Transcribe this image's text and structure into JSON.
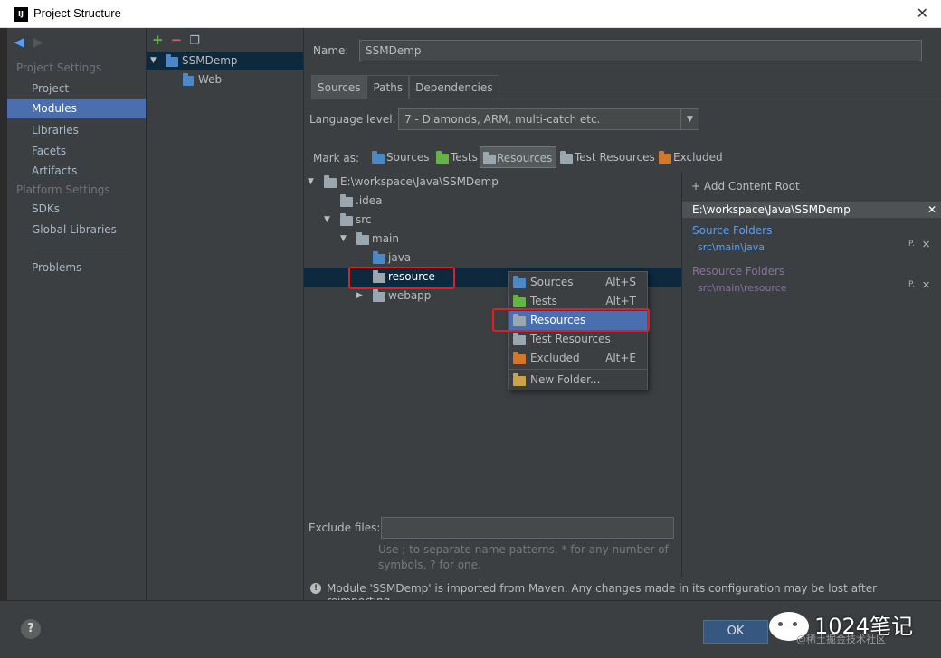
{
  "window": {
    "title": "Project Structure",
    "app_icon": "IJ"
  },
  "nav": {
    "group1": "Project Settings",
    "items1": [
      "Project",
      "Modules",
      "Libraries",
      "Facets",
      "Artifacts"
    ],
    "group2": "Platform Settings",
    "items2": [
      "SDKs",
      "Global Libraries"
    ],
    "items3": [
      "Problems"
    ],
    "selected": "Modules"
  },
  "modules": {
    "tree": [
      {
        "label": "SSMDemp",
        "selected": true
      },
      {
        "label": "Web",
        "selected": false
      }
    ]
  },
  "main": {
    "name_label": "Name:",
    "name_value": "SSMDemp",
    "tabs": [
      "Sources",
      "Paths",
      "Dependencies"
    ],
    "active_tab": "Sources",
    "language_level_label": "Language level:",
    "language_level_value": "7 - Diamonds, ARM, multi-catch etc.",
    "mark_as_label": "Mark as:",
    "mark_as": [
      {
        "label": "Sources",
        "color": "#4a88c7"
      },
      {
        "label": "Tests",
        "color": "#62b543"
      },
      {
        "label": "Resources",
        "color": "#9aa7b0",
        "selected": true
      },
      {
        "label": "Test Resources",
        "color": "#9aa7b0"
      },
      {
        "label": "Excluded",
        "color": "#d3772b"
      }
    ],
    "tree": [
      {
        "label": "E:\\workspace\\Java\\SSMDemp",
        "expanded": true
      },
      {
        "label": ".idea"
      },
      {
        "label": "src",
        "expanded": true
      },
      {
        "label": "main",
        "expanded": true
      },
      {
        "label": "java"
      },
      {
        "label": "resource",
        "selected": true
      },
      {
        "label": "webapp",
        "expanded": false
      }
    ],
    "exclude_label": "Exclude files:",
    "exclude_value": "",
    "exclude_hint_1": "Use ; to separate name patterns, * for any number of",
    "exclude_hint_2": "symbols, ? for one.",
    "info": "Module 'SSMDemp' is imported from Maven. Any changes made in its configuration may be lost after reimporting."
  },
  "roots": {
    "add_label": "+ Add Content Root",
    "root_path": "E:\\workspace\\Java\\SSMDemp",
    "source_title": "Source Folders",
    "source_path": "src\\main\\java",
    "resource_title": "Resource Folders",
    "resource_path": "src\\main\\resource",
    "source_color": "#589df6",
    "resource_color": "#8a6fa0"
  },
  "context_menu": [
    {
      "label": "Sources",
      "shortcut": "Alt+S",
      "color": "#4a88c7"
    },
    {
      "label": "Tests",
      "shortcut": "Alt+T",
      "color": "#62b543"
    },
    {
      "label": "Resources",
      "shortcut": "",
      "color": "#9aa7b0",
      "selected": true
    },
    {
      "label": "Test Resources",
      "shortcut": "",
      "color": "#9aa7b0"
    },
    {
      "label": "Excluded",
      "shortcut": "Alt+E",
      "color": "#d3772b"
    },
    {
      "label": "New Folder...",
      "shortcut": "",
      "color": "#c9a24a"
    }
  ],
  "footer": {
    "help": "?",
    "ok": "OK",
    "watermark": "1024笔记",
    "watermark_sub": "@稀土掘金技术社区"
  }
}
